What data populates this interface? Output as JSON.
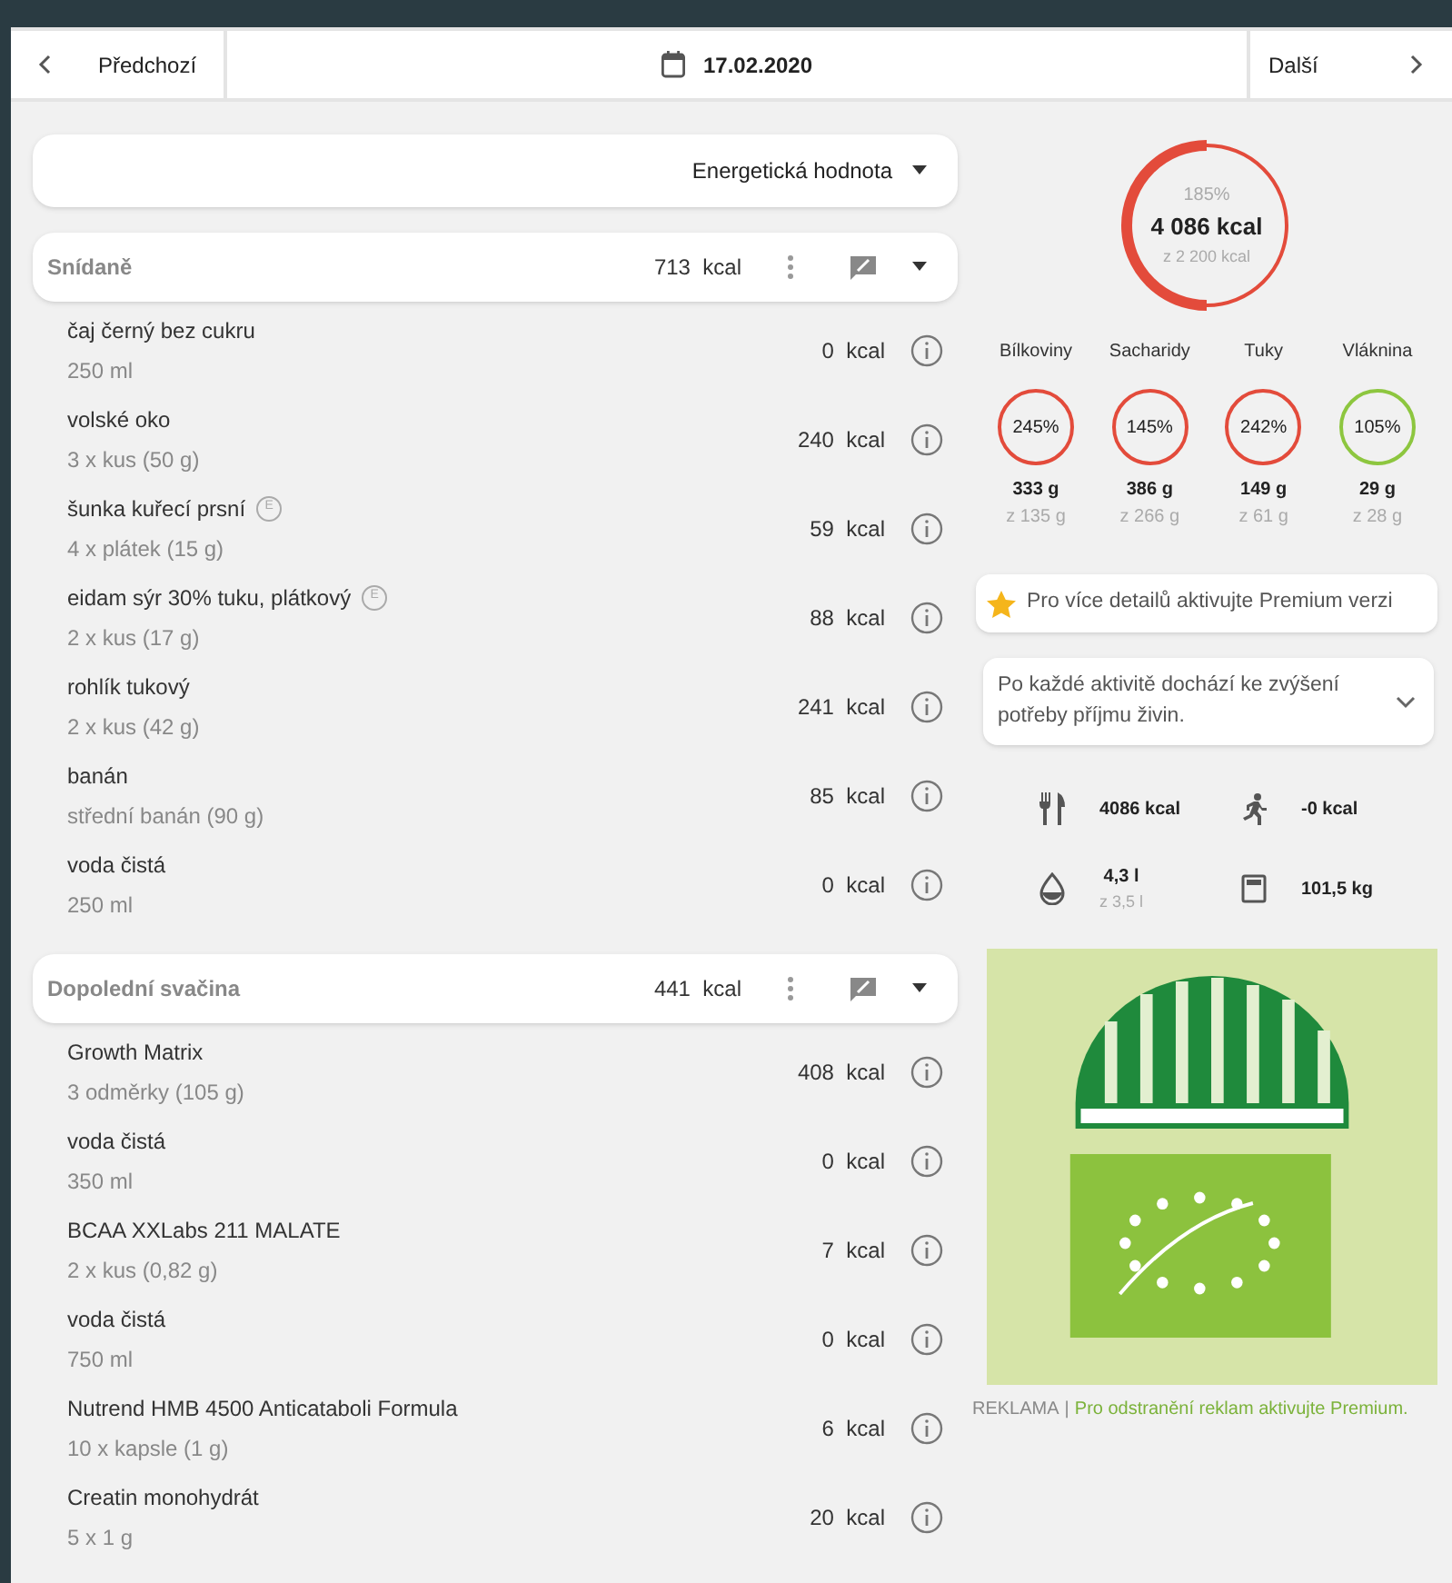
{
  "nav": {
    "prev": "Předchozí",
    "date": "17.02.2020",
    "next": "Další"
  },
  "view_select": {
    "value": "Energetická hodnota"
  },
  "meals": [
    {
      "title": "Snídaně",
      "kcal": "713",
      "unit": "kcal",
      "items": [
        {
          "name": "čaj černý bez cukru",
          "amount": "250 ml",
          "kcal": "0",
          "unit": "kcal"
        },
        {
          "name": "volské oko",
          "amount": "3 x kus (50 g)",
          "kcal": "240",
          "unit": "kcal"
        },
        {
          "name": "šunka kuřecí prsní",
          "tag": "E",
          "amount": "4 x plátek (15 g)",
          "kcal": "59",
          "unit": "kcal"
        },
        {
          "name": "eidam sýr 30% tuku, plátkový",
          "tag": "E",
          "amount": "2 x kus (17 g)",
          "kcal": "88",
          "unit": "kcal"
        },
        {
          "name": "rohlík tukový",
          "amount": "2 x kus (42 g)",
          "kcal": "241",
          "unit": "kcal"
        },
        {
          "name": "banán",
          "amount": "střední banán (90 g)",
          "kcal": "85",
          "unit": "kcal"
        },
        {
          "name": "voda čistá",
          "amount": "250 ml",
          "kcal": "0",
          "unit": "kcal"
        }
      ]
    },
    {
      "title": "Dopolední svačina",
      "kcal": "441",
      "unit": "kcal",
      "items": [
        {
          "name": "Growth Matrix",
          "amount": "3 odměrky (105 g)",
          "kcal": "408",
          "unit": "kcal"
        },
        {
          "name": "voda čistá",
          "amount": "350 ml",
          "kcal": "0",
          "unit": "kcal"
        },
        {
          "name": "BCAA XXLabs 211 MALATE",
          "amount": "2 x kus (0,82 g)",
          "kcal": "7",
          "unit": "kcal"
        },
        {
          "name": "voda čistá",
          "amount": "750 ml",
          "kcal": "0",
          "unit": "kcal"
        },
        {
          "name": "Nutrend HMB 4500 Anticataboli Formula",
          "amount": "10 x kapsle (1 g)",
          "kcal": "6",
          "unit": "kcal"
        },
        {
          "name": "Creatin monohydrát",
          "amount": "5 x 1 g",
          "kcal": "20",
          "unit": "kcal"
        }
      ]
    }
  ],
  "energy": {
    "percent": "185%",
    "value": "4 086 kcal",
    "goal": "z 2 200 kcal",
    "color": "#e34b3b"
  },
  "nutrients": [
    {
      "label": "Bílkoviny",
      "percent": "245%",
      "amount": "333 g",
      "goal": "z 135 g",
      "color": "#e34b3b"
    },
    {
      "label": "Sacharidy",
      "percent": "145%",
      "amount": "386 g",
      "goal": "z 266 g",
      "color": "#e34b3b"
    },
    {
      "label": "Tuky",
      "percent": "242%",
      "amount": "149 g",
      "goal": "z 61 g",
      "color": "#e34b3b"
    },
    {
      "label": "Vláknina",
      "percent": "105%",
      "amount": "29 g",
      "goal": "z 28 g",
      "color": "#8dc63f"
    }
  ],
  "premium_notice": "Pro více detailů aktivujte Premium verzi",
  "activity_note": {
    "text": "Po každé aktivitě dochází ke zvýšení potřeby příjmu živin.",
    "expanded": false
  },
  "stats": [
    {
      "kind": "food",
      "value": "4086 kcal"
    },
    {
      "kind": "activity",
      "value": "-0 kcal"
    },
    {
      "kind": "water",
      "value": "4,3 l",
      "goal": "z 3,5 l"
    },
    {
      "kind": "weight",
      "value": "101,5 kg"
    }
  ],
  "ad": {
    "kind": "picture",
    "label": "REKLAMA",
    "separator": "|",
    "link": "Pro odstranění reklam aktivujte Premium."
  }
}
